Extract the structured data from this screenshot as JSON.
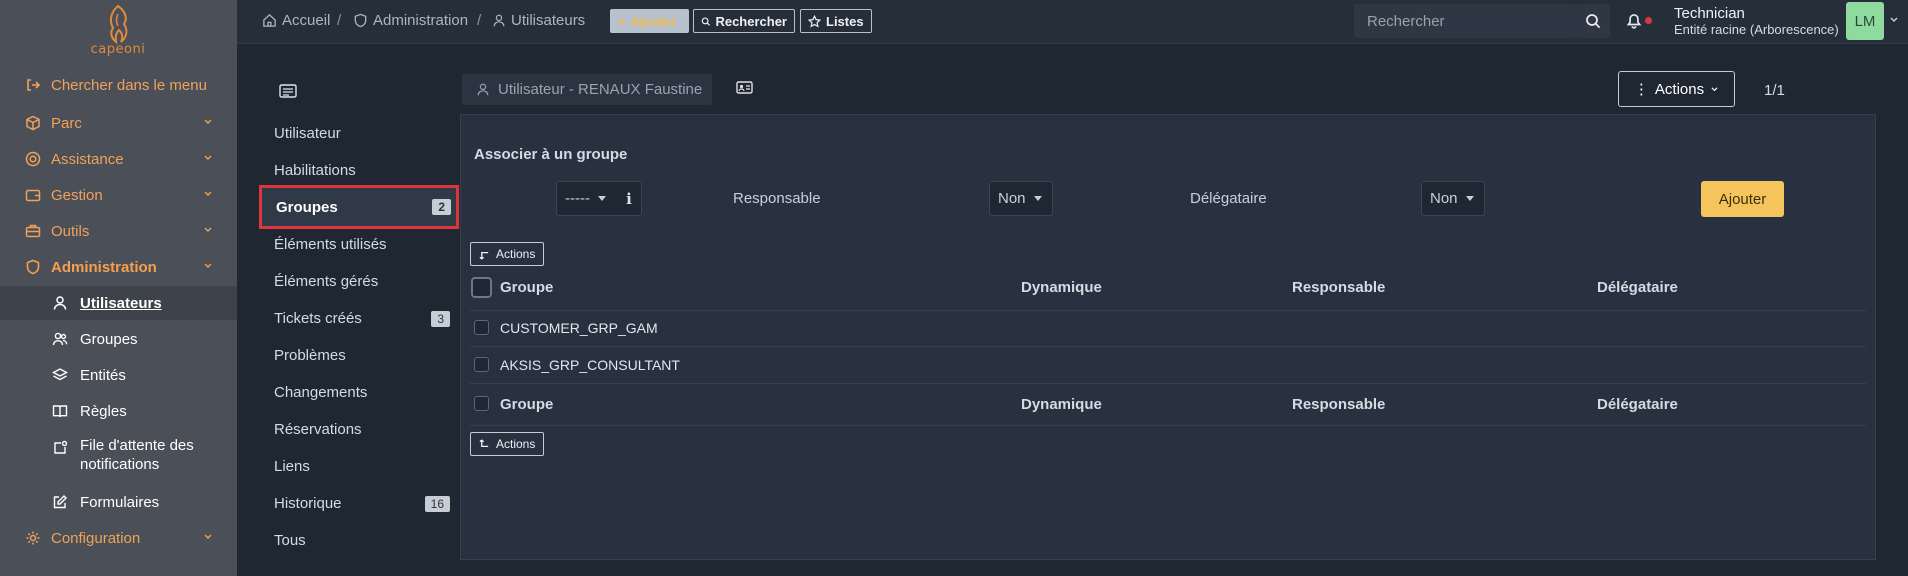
{
  "brand": {
    "logo_text": "capeoni"
  },
  "sidebar": {
    "items": [
      {
        "label": "Chercher dans le menu",
        "icon": "arrow-right-to-bracket-icon"
      },
      {
        "label": "Parc",
        "icon": "box-icon"
      },
      {
        "label": "Assistance",
        "icon": "lifebuoy-icon"
      },
      {
        "label": "Gestion",
        "icon": "wallet-icon"
      },
      {
        "label": "Outils",
        "icon": "briefcase-icon"
      },
      {
        "label": "Administration",
        "icon": "shield-icon"
      },
      {
        "label": "Configuration",
        "icon": "gear-icon"
      }
    ],
    "sub_items": [
      {
        "label": "Utilisateurs",
        "icon": "user-icon"
      },
      {
        "label": "Groupes",
        "icon": "users-icon"
      },
      {
        "label": "Entités",
        "icon": "layers-icon"
      },
      {
        "label": "Règles",
        "icon": "book-icon"
      },
      {
        "label": "File d'attente des notifications",
        "icon": "notification-queue-icon"
      },
      {
        "label": "Formulaires",
        "icon": "edit-icon"
      }
    ]
  },
  "topbar": {
    "breadcrumbs": [
      "Accueil",
      "Administration",
      "Utilisateurs"
    ],
    "buttons": {
      "add": "Ajouter",
      "search": "Rechercher",
      "lists": "Listes"
    },
    "search_placeholder": "Rechercher",
    "user": {
      "name": "Technician",
      "entity": "Entité racine (Arborescence)",
      "initials": "LM"
    }
  },
  "tabs": [
    {
      "label": "Utilisateur",
      "badge": ""
    },
    {
      "label": "Habilitations",
      "badge": ""
    },
    {
      "label": "Groupes",
      "badge": "2"
    },
    {
      "label": "Éléments utilisés",
      "badge": ""
    },
    {
      "label": "Éléments gérés",
      "badge": ""
    },
    {
      "label": "Tickets créés",
      "badge": "3"
    },
    {
      "label": "Problèmes",
      "badge": ""
    },
    {
      "label": "Changements",
      "badge": ""
    },
    {
      "label": "Réservations",
      "badge": ""
    },
    {
      "label": "Liens",
      "badge": ""
    },
    {
      "label": "Historique",
      "badge": "16"
    },
    {
      "label": "Tous",
      "badge": ""
    }
  ],
  "main": {
    "header_title": "Utilisateur - RENAUX Faustine",
    "actions_label": "Actions",
    "pager": "1/1",
    "form": {
      "title": "Associer à un groupe",
      "group_select": "-----",
      "responsable_label": "Responsable",
      "responsable_value": "Non",
      "delegataire_label": "Délégataire",
      "delegataire_value": "Non",
      "add_button": "Ajouter"
    },
    "mass_actions_label": "Actions",
    "table": {
      "columns": [
        "Groupe",
        "Dynamique",
        "Responsable",
        "Délégataire"
      ],
      "rows": [
        {
          "groupe": "CUSTOMER_GRP_GAM",
          "dynamique": "",
          "responsable": "",
          "delegataire": ""
        },
        {
          "groupe": "AKSIS_GRP_CONSULTANT",
          "dynamique": "",
          "responsable": "",
          "delegataire": ""
        }
      ]
    }
  },
  "colors": {
    "accent": "#f6a04d",
    "active_tab_border": "#e0343b",
    "add_button": "#f5c45a",
    "avatar": "#8fdb9f"
  }
}
